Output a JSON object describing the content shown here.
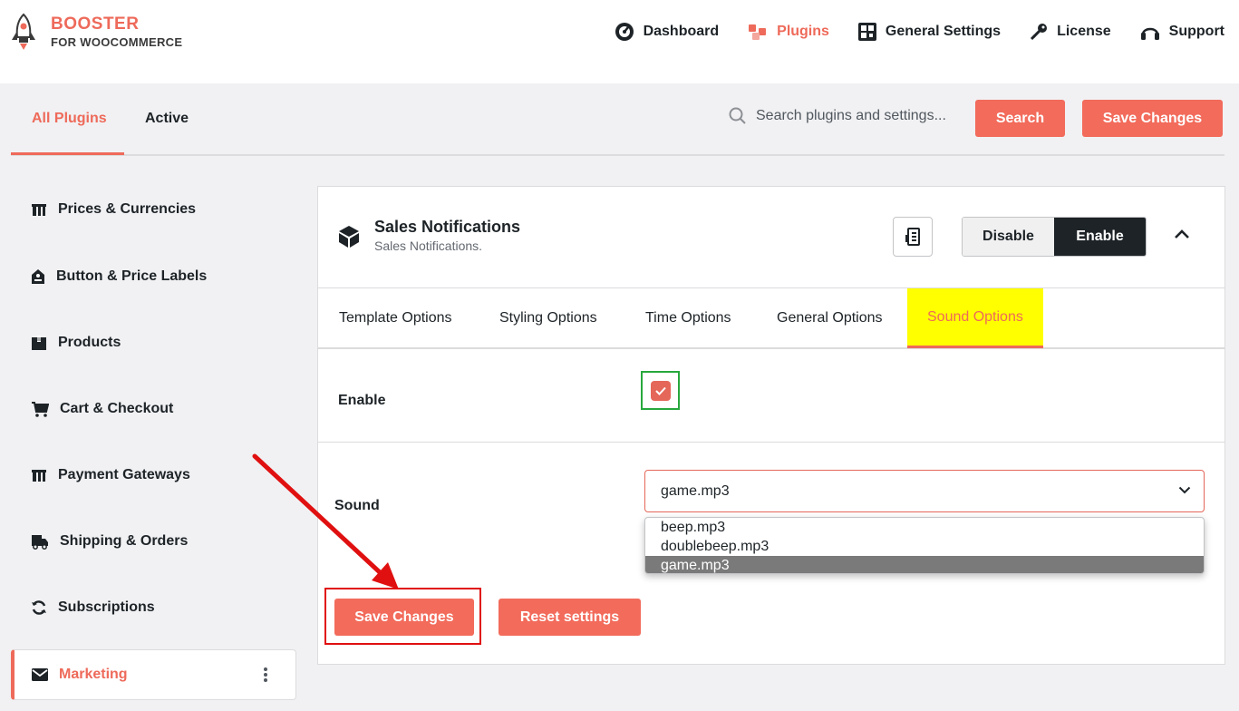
{
  "brand": {
    "line1": "BOOSTER",
    "line2": "FOR WOOCOMMERCE"
  },
  "nav": [
    {
      "label": "Dashboard",
      "icon": "speedometer-icon"
    },
    {
      "label": "Plugins",
      "icon": "cubes-icon",
      "active": true
    },
    {
      "label": "General Settings",
      "icon": "grid-icon"
    },
    {
      "label": "License",
      "icon": "key-icon"
    },
    {
      "label": "Support",
      "icon": "headphones-icon"
    }
  ],
  "plugin_tabs": {
    "all": "All Plugins",
    "active": "Active"
  },
  "search": {
    "placeholder": "Search plugins and settings...",
    "button": "Search"
  },
  "save_changes": "Save Changes",
  "sidebar": {
    "items": [
      {
        "label": "Prices & Currencies",
        "icon": "price-tag-icon"
      },
      {
        "label": "Button & Price Labels",
        "icon": "label-icon"
      },
      {
        "label": "Products",
        "icon": "box-icon"
      },
      {
        "label": "Cart & Checkout",
        "icon": "cart-icon"
      },
      {
        "label": "Payment Gateways",
        "icon": "payment-icon"
      },
      {
        "label": "Shipping & Orders",
        "icon": "truck-icon"
      },
      {
        "label": "Subscriptions",
        "icon": "refresh-icon"
      },
      {
        "label": "Marketing",
        "icon": "envelope-icon",
        "selected": true
      }
    ]
  },
  "module": {
    "title": "Sales Notifications",
    "subtitle": "Sales Notifications.",
    "disable": "Disable",
    "enable": "Enable",
    "tabs": [
      "Template Options",
      "Styling Options",
      "Time Options",
      "General Options",
      "Sound Options"
    ],
    "active_tab": "Sound Options",
    "enable_label": "Enable",
    "enable_checked": true,
    "sound_label": "Sound",
    "sound_value": "game.mp3",
    "sound_options": [
      "beep.mp3",
      "doublebeep.mp3",
      "game.mp3"
    ],
    "reset_label": "Reset settings"
  },
  "colors": {
    "accent": "#f26b5b",
    "dark": "#1d2327",
    "highlight": "#ffff00",
    "annotation": "#e01010"
  }
}
